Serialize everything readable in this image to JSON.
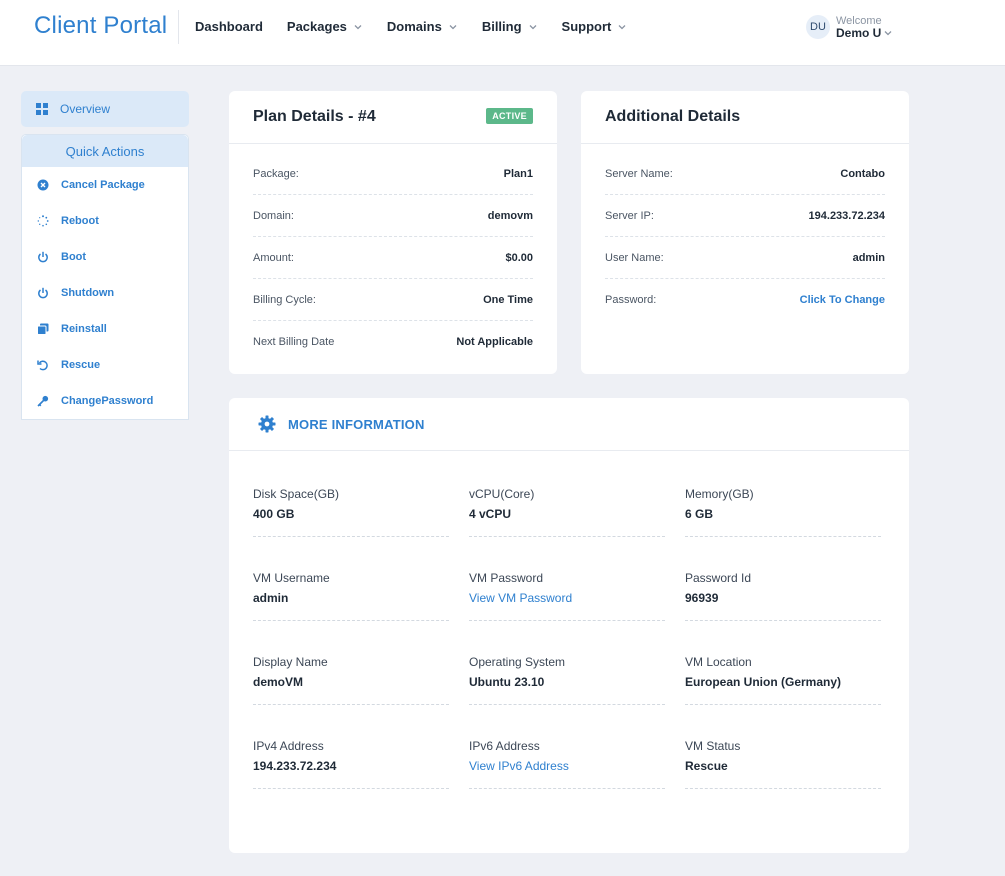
{
  "header": {
    "brand": "Client Portal",
    "nav": [
      {
        "label": "Dashboard",
        "has_menu": false
      },
      {
        "label": "Packages",
        "has_menu": true
      },
      {
        "label": "Domains",
        "has_menu": true
      },
      {
        "label": "Billing",
        "has_menu": true
      },
      {
        "label": "Support",
        "has_menu": true
      }
    ],
    "user": {
      "initials": "DU",
      "welcome": "Welcome",
      "name": "Demo U"
    }
  },
  "sidebar": {
    "overview": "Overview",
    "quick_actions_title": "Quick Actions",
    "actions": [
      {
        "label": "Cancel Package",
        "icon": "close-circle-icon"
      },
      {
        "label": "Reboot",
        "icon": "spinner-icon"
      },
      {
        "label": "Boot",
        "icon": "power-icon"
      },
      {
        "label": "Shutdown",
        "icon": "power-icon"
      },
      {
        "label": "Reinstall",
        "icon": "copy-icon"
      },
      {
        "label": "Rescue",
        "icon": "undo-icon"
      },
      {
        "label": "ChangePassword",
        "icon": "key-icon"
      }
    ]
  },
  "plan": {
    "title": "Plan Details - #4",
    "status": "ACTIVE",
    "rows": [
      {
        "label": "Package:",
        "value": "Plan1"
      },
      {
        "label": "Domain:",
        "value": "demovm"
      },
      {
        "label": "Amount:",
        "value": "$0.00"
      },
      {
        "label": "Billing Cycle:",
        "value": "One Time"
      },
      {
        "label": "Next Billing Date",
        "value": "Not Applicable"
      }
    ]
  },
  "additional": {
    "title": "Additional Details",
    "rows": [
      {
        "label": "Server Name:",
        "value": "Contabo"
      },
      {
        "label": "Server IP:",
        "value": "194.233.72.234"
      },
      {
        "label": "User Name:",
        "value": "admin"
      },
      {
        "label": "Password:",
        "value": "Click To Change"
      }
    ]
  },
  "more": {
    "title": "MORE INFORMATION",
    "items": [
      {
        "label": "Disk Space(GB)",
        "value": "400 GB"
      },
      {
        "label": "vCPU(Core)",
        "value": "4 vCPU"
      },
      {
        "label": "Memory(GB)",
        "value": "6 GB"
      },
      {
        "label": "VM Username",
        "value": "admin"
      },
      {
        "label": "VM Password",
        "value": "View VM Password"
      },
      {
        "label": "Password Id",
        "value": "96939"
      },
      {
        "label": "Display Name",
        "value": "demoVM"
      },
      {
        "label": "Operating System",
        "value": "Ubuntu 23.10"
      },
      {
        "label": "VM Location",
        "value": "European Union (Germany)"
      },
      {
        "label": "IPv4 Address",
        "value": "194.233.72.234"
      },
      {
        "label": "IPv6 Address",
        "value": "View IPv6 Address"
      },
      {
        "label": "VM Status",
        "value": "Rescue"
      }
    ]
  },
  "colors": {
    "accent": "#2f80cf",
    "active_badge": "#5cb88a",
    "background": "#eef0f5"
  }
}
